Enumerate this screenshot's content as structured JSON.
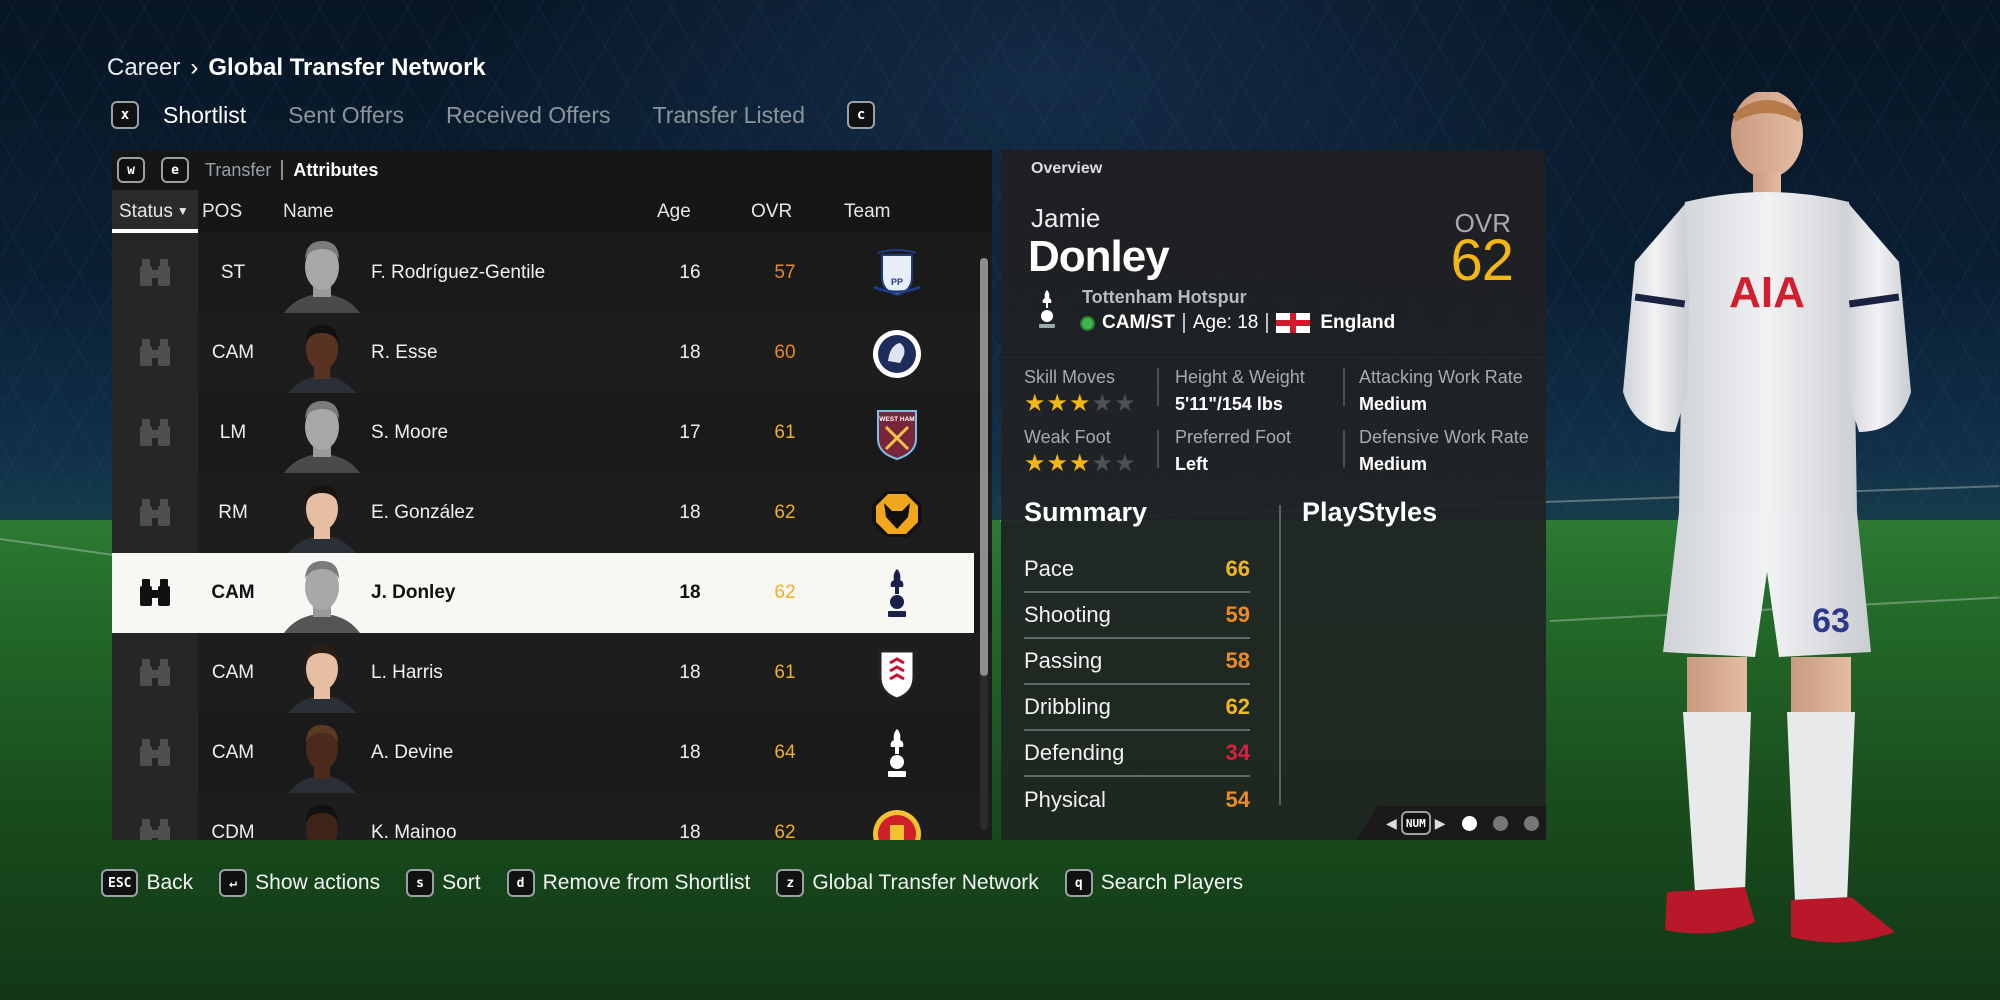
{
  "breadcrumb": {
    "root": "Career",
    "separator": "›",
    "current": "Global Transfer Network"
  },
  "tabs": {
    "prev_key": "x",
    "next_key": "c",
    "items": [
      {
        "label": "Shortlist",
        "active": true
      },
      {
        "label": "Sent Offers",
        "active": false
      },
      {
        "label": "Received Offers",
        "active": false
      },
      {
        "label": "Transfer Listed",
        "active": false
      }
    ]
  },
  "list_panel": {
    "subtabs": {
      "prev_key": "w",
      "next_key": "e",
      "items": [
        {
          "label": "Transfer",
          "active": false
        },
        {
          "label": "Attributes",
          "active": true
        }
      ]
    },
    "columns": {
      "status": "Status",
      "status_sort": "▼",
      "pos": "POS",
      "name": "Name",
      "age": "Age",
      "ovr": "OVR",
      "team": "Team"
    },
    "scroll_fraction": 0.73,
    "players": [
      {
        "pos": "ST",
        "name": "F. Rodríguez-Gentile",
        "age": "16",
        "ovr": "57",
        "ovr_color": "#e8862a",
        "team": "Preston North End",
        "team_icon": "preston-crest-icon",
        "avatar": "placeholder",
        "selected": false
      },
      {
        "pos": "CAM",
        "name": "R. Esse",
        "age": "18",
        "ovr": "60",
        "ovr_color": "#e8862a",
        "team": "Millwall",
        "team_icon": "millwall-crest-icon",
        "avatar": "photo",
        "selected": false
      },
      {
        "pos": "LM",
        "name": "S. Moore",
        "age": "17",
        "ovr": "61",
        "ovr_color": "#e9b221",
        "team": "West Ham United",
        "team_icon": "west-ham-crest-icon",
        "avatar": "placeholder",
        "selected": false
      },
      {
        "pos": "RM",
        "name": "E. González",
        "age": "18",
        "ovr": "62",
        "ovr_color": "#e9b221",
        "team": "Wolverhampton Wanderers",
        "team_icon": "wolves-crest-icon",
        "avatar": "photo",
        "selected": false
      },
      {
        "pos": "CAM",
        "name": "J. Donley",
        "age": "18",
        "ovr": "62",
        "ovr_color": "#e9b221",
        "team": "Tottenham Hotspur",
        "team_icon": "tottenham-crest-icon",
        "avatar": "placeholder",
        "selected": true
      },
      {
        "pos": "CAM",
        "name": "L. Harris",
        "age": "18",
        "ovr": "61",
        "ovr_color": "#e9b221",
        "team": "Fulham",
        "team_icon": "fulham-crest-icon",
        "avatar": "photo",
        "selected": false
      },
      {
        "pos": "CAM",
        "name": "A. Devine",
        "age": "18",
        "ovr": "64",
        "ovr_color": "#e9b221",
        "team": "Tottenham Hotspur",
        "team_icon": "tottenham-crest-icon",
        "avatar": "photo",
        "selected": false
      },
      {
        "pos": "CDM",
        "name": "K. Mainoo",
        "age": "18",
        "ovr": "62",
        "ovr_color": "#e9b221",
        "team": "Manchester United",
        "team_icon": "man-utd-crest-icon",
        "avatar": "photo",
        "selected": false
      }
    ]
  },
  "overview": {
    "label": "Overview",
    "first_name": "Jamie",
    "last_name": "Donley",
    "ovr_label": "OVR",
    "ovr": "62",
    "club": "Tottenham Hotspur",
    "positions": "CAM/ST",
    "age_text": "Age: 18",
    "nation": "England",
    "skill_moves_label": "Skill Moves",
    "skill_moves_stars": 3,
    "weak_foot_label": "Weak Foot",
    "weak_foot_stars": 3,
    "max_stars": 5,
    "height_weight_label": "Height & Weight",
    "height_weight": "5'11\"/154 lbs",
    "preferred_foot_label": "Preferred Foot",
    "preferred_foot": "Left",
    "attacking_wr_label": "Attacking Work Rate",
    "attacking_wr": "Medium",
    "defensive_wr_label": "Defensive Work Rate",
    "defensive_wr": "Medium",
    "summary_title": "Summary",
    "playstyles_title": "PlayStyles",
    "stats": [
      {
        "label": "Pace",
        "value": "66",
        "color": "#f0b81c"
      },
      {
        "label": "Shooting",
        "value": "59",
        "color": "#ec8a24"
      },
      {
        "label": "Passing",
        "value": "58",
        "color": "#ec8a24"
      },
      {
        "label": "Dribbling",
        "value": "62",
        "color": "#f0b81c"
      },
      {
        "label": "Defending",
        "value": "34",
        "color": "#d8203f"
      },
      {
        "label": "Physical",
        "value": "54",
        "color": "#ec8a24"
      }
    ],
    "pager": {
      "key": "NUM",
      "pages": 3,
      "current": 1
    }
  },
  "footer": [
    {
      "key": "ESC",
      "label": "Back"
    },
    {
      "key": "↵",
      "label": "Show actions"
    },
    {
      "key": "s",
      "label": "Sort"
    },
    {
      "key": "d",
      "label": "Remove from Shortlist"
    },
    {
      "key": "z",
      "label": "Global Transfer Network"
    },
    {
      "key": "q",
      "label": "Search Players"
    }
  ],
  "colors": {
    "accent_gold": "#f2b713",
    "selected_row": "#f7f7f4",
    "panel": "#161616"
  }
}
